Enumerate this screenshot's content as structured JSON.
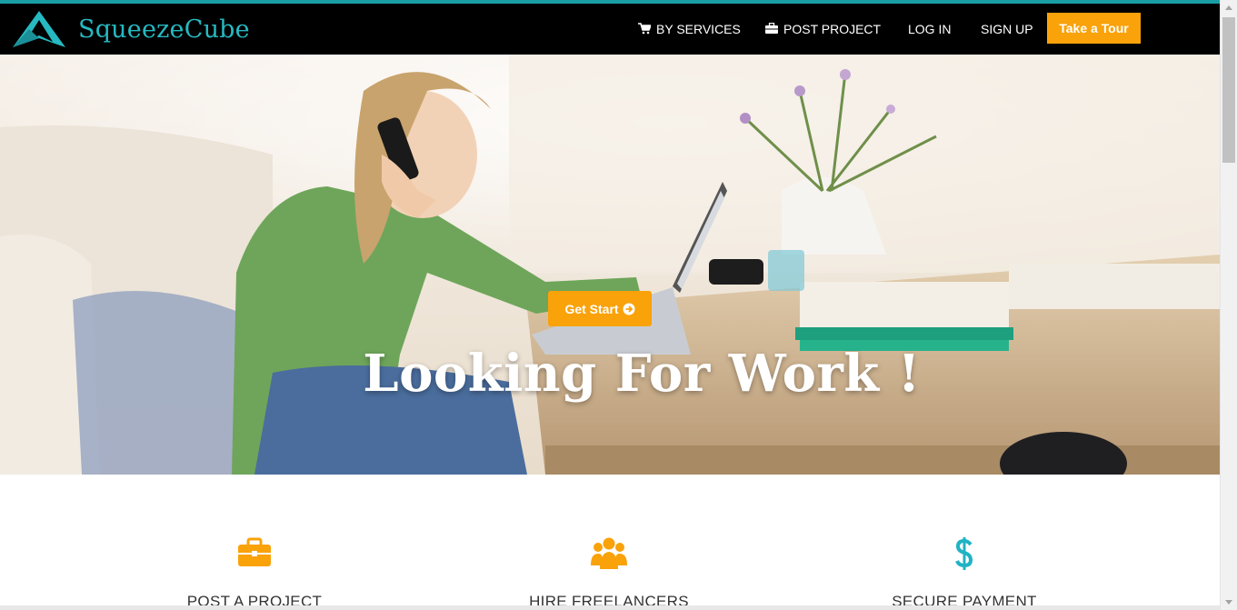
{
  "brand": {
    "name": "SqueezeCube",
    "logo_icon": "squeezecube-logo-icon"
  },
  "nav": {
    "services_label": "BY SERVICES",
    "post_label": "POST PROJECT",
    "login_label": "LOG IN",
    "signup_label": "SIGN UP",
    "tour_label": "Take a Tour"
  },
  "hero": {
    "cta_label": "Get Start",
    "title": "Looking For Work !"
  },
  "features": [
    {
      "label": "POST A PROJECT",
      "icon": "briefcase-icon"
    },
    {
      "label": "HIRE FREELANCERS",
      "icon": "users-icon"
    },
    {
      "label": "SECURE PAYMENT",
      "icon": "dollar-icon"
    }
  ],
  "colors": {
    "accent": "#f9a20a",
    "brand_teal": "#26b9c1",
    "navbar_bg": "#000000",
    "secure_icon": "#1fb3c4"
  }
}
